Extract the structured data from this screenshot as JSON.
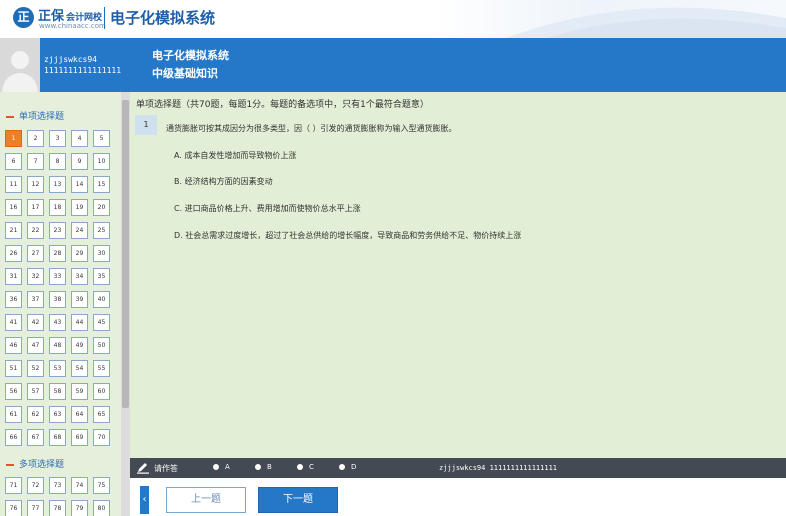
{
  "brand": {
    "logo_char": "正",
    "name": "正保",
    "name_sub": "会计网校",
    "url": "www.chinaacc.com",
    "title": "电子化模拟系统"
  },
  "header": {
    "user_id": "zjjjswkcs94",
    "user_number": "1111111111111111",
    "system_title": "电子化模拟系统",
    "subject": "中级基础知识"
  },
  "sidebar": {
    "section_single": "单项选择题",
    "section_multi": "多项选择题",
    "single_numbers": [
      "1",
      "2",
      "3",
      "4",
      "5",
      "6",
      "7",
      "8",
      "9",
      "10",
      "11",
      "12",
      "13",
      "14",
      "15",
      "16",
      "17",
      "18",
      "19",
      "20",
      "21",
      "22",
      "23",
      "24",
      "25",
      "26",
      "27",
      "28",
      "29",
      "30",
      "31",
      "32",
      "33",
      "34",
      "35",
      "36",
      "37",
      "38",
      "39",
      "40",
      "41",
      "42",
      "43",
      "44",
      "45",
      "46",
      "47",
      "48",
      "49",
      "50",
      "51",
      "52",
      "53",
      "54",
      "55",
      "56",
      "57",
      "58",
      "59",
      "60",
      "61",
      "62",
      "63",
      "64",
      "65",
      "66",
      "67",
      "68",
      "69",
      "70"
    ],
    "multi_numbers": [
      "71",
      "72",
      "73",
      "74",
      "75",
      "76",
      "77",
      "78",
      "79",
      "80"
    ],
    "active_number": "1"
  },
  "question": {
    "section_header": "单项选择题（共70题，每题1分。每题的备选项中，只有1个最符合题意）",
    "number": "1",
    "text": "通货膨胀可按其成因分为很多类型，因（   ）引发的通货膨胀称为输入型通货膨胀。",
    "options": [
      "A. 成本自发性增加而导致物价上涨",
      "B. 经济结构方面的因素变动",
      "C. 进口商品价格上升、费用增加而使物价总水平上涨",
      "D. 社会总需求过度增长，超过了社会总供给的增长幅度，导致商品和劳务供给不足、物价持续上涨"
    ]
  },
  "answer_bar": {
    "label": "请作答",
    "choices": [
      "A",
      "B",
      "C",
      "D"
    ],
    "user_info": "zjjjswkcs94 1111111111111111"
  },
  "nav": {
    "collapse": "‹",
    "prev": "上一题",
    "next": "下一题"
  },
  "colors": {
    "primary_blue": "#2578c8",
    "sidebar_bg": "#e6efdc",
    "main_bg": "#e2efd6",
    "active_orange": "#ec7f27",
    "answer_bar": "#434a54"
  }
}
